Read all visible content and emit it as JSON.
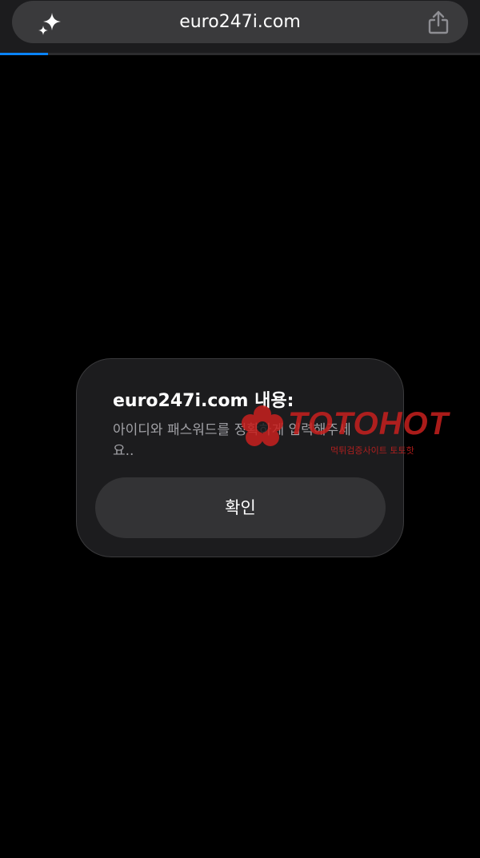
{
  "browser": {
    "url": "euro247i.com",
    "sparkle_icon": "sparkle-icon",
    "share_icon": "share-icon",
    "load_progress": 0.1,
    "accent_color": "#0a84ff"
  },
  "alert": {
    "title": "euro247i.com 내용:",
    "message": "아이디와 패스워드를 정확하게 입력해주세요..",
    "ok_label": "확인"
  },
  "watermark": {
    "brand": "TOTOHOT",
    "tagline": "먹튀검증사이트 토토핫",
    "color": "#c8201e"
  }
}
